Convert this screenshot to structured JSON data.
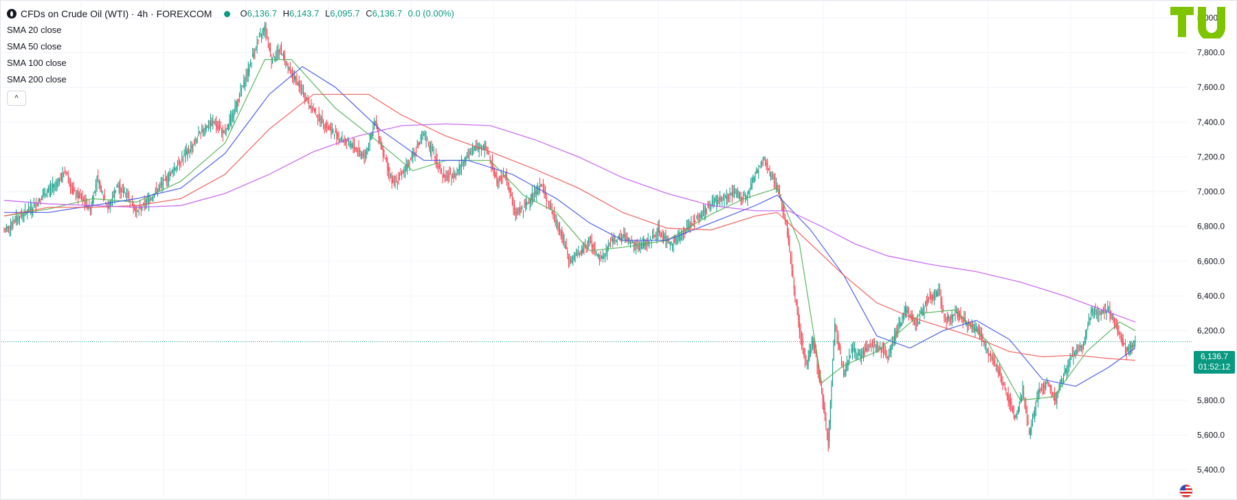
{
  "header": {
    "title": "CFDs on Crude Oil (WTI) · 4h · FOREXCOM",
    "ohlc": [
      {
        "key": "O",
        "value": "6,136.7"
      },
      {
        "key": "H",
        "value": "6,143.7"
      },
      {
        "key": "L",
        "value": "6,095.7"
      },
      {
        "key": "C",
        "value": "6,136.7"
      },
      {
        "key": "",
        "value": "0.0 (0.00%)"
      }
    ]
  },
  "indicators": [
    {
      "label": "SMA 20 close",
      "color": "#4caf50"
    },
    {
      "label": "SMA 50 close",
      "color": "#3f51e6"
    },
    {
      "label": "SMA 100 close",
      "color": "#ef5350"
    },
    {
      "label": "SMA 200 close",
      "color": "#c154f0"
    }
  ],
  "collapse_glyph": "^",
  "last_price": {
    "value": "6,136.7",
    "countdown": "01:52:12",
    "color": "#089981"
  },
  "colors": {
    "up": "#089981",
    "down": "#f23645",
    "grid": "#f0f3fa",
    "axis_text": "#131722"
  },
  "chart_data": {
    "type": "candlestick",
    "ylim": [
      5400,
      8100
    ],
    "y_ticks": [
      "8,000.0",
      "7,800.0",
      "7,600.0",
      "7,400.0",
      "7,200.0",
      "7,000.0",
      "6,800.0",
      "6,600.0",
      "6,400.0",
      "6,200.0",
      "6,000.0",
      "5,800.0",
      "5,600.0",
      "5,400.0"
    ],
    "y_tick_values": [
      8000,
      7800,
      7600,
      7400,
      7200,
      7000,
      6800,
      6600,
      6400,
      6200,
      6000,
      5800,
      5600,
      5400
    ],
    "last_value": 6136.7,
    "close_path": [
      [
        0,
        6770
      ],
      [
        12,
        6850
      ],
      [
        24,
        6900
      ],
      [
        36,
        6980
      ],
      [
        48,
        7050
      ],
      [
        56,
        7120
      ],
      [
        62,
        7000
      ],
      [
        70,
        6960
      ],
      [
        78,
        6900
      ],
      [
        84,
        7080
      ],
      [
        94,
        6900
      ],
      [
        102,
        7030
      ],
      [
        112,
        6980
      ],
      [
        120,
        6880
      ],
      [
        130,
        6950
      ],
      [
        140,
        7020
      ],
      [
        150,
        7100
      ],
      [
        160,
        7180
      ],
      [
        170,
        7260
      ],
      [
        180,
        7360
      ],
      [
        190,
        7400
      ],
      [
        200,
        7330
      ],
      [
        210,
        7500
      ],
      [
        220,
        7680
      ],
      [
        228,
        7840
      ],
      [
        236,
        7950
      ],
      [
        242,
        7760
      ],
      [
        250,
        7820
      ],
      [
        258,
        7700
      ],
      [
        266,
        7620
      ],
      [
        276,
        7500
      ],
      [
        286,
        7420
      ],
      [
        296,
        7350
      ],
      [
        306,
        7300
      ],
      [
        316,
        7260
      ],
      [
        326,
        7200
      ],
      [
        336,
        7400
      ],
      [
        344,
        7200
      ],
      [
        352,
        7040
      ],
      [
        362,
        7120
      ],
      [
        372,
        7240
      ],
      [
        380,
        7320
      ],
      [
        390,
        7200
      ],
      [
        398,
        7080
      ],
      [
        408,
        7100
      ],
      [
        418,
        7200
      ],
      [
        428,
        7260
      ],
      [
        436,
        7260
      ],
      [
        446,
        7060
      ],
      [
        454,
        7100
      ],
      [
        462,
        6880
      ],
      [
        470,
        6900
      ],
      [
        478,
        6980
      ],
      [
        486,
        7040
      ],
      [
        496,
        6880
      ],
      [
        504,
        6760
      ],
      [
        512,
        6600
      ],
      [
        522,
        6650
      ],
      [
        530,
        6720
      ],
      [
        540,
        6600
      ],
      [
        550,
        6720
      ],
      [
        562,
        6740
      ],
      [
        572,
        6680
      ],
      [
        582,
        6700
      ],
      [
        592,
        6780
      ],
      [
        602,
        6700
      ],
      [
        612,
        6740
      ],
      [
        622,
        6820
      ],
      [
        632,
        6880
      ],
      [
        642,
        6940
      ],
      [
        652,
        6960
      ],
      [
        662,
        6990
      ],
      [
        672,
        6960
      ],
      [
        680,
        7100
      ],
      [
        688,
        7180
      ],
      [
        696,
        7080
      ],
      [
        702,
        6980
      ],
      [
        708,
        6820
      ],
      [
        714,
        6500
      ],
      [
        720,
        6200
      ],
      [
        726,
        6000
      ],
      [
        732,
        6150
      ],
      [
        740,
        5850
      ],
      [
        746,
        5550
      ],
      [
        752,
        6250
      ],
      [
        760,
        5950
      ],
      [
        768,
        6100
      ],
      [
        776,
        6060
      ],
      [
        784,
        6120
      ],
      [
        792,
        6100
      ],
      [
        800,
        6050
      ],
      [
        808,
        6200
      ],
      [
        816,
        6320
      ],
      [
        826,
        6240
      ],
      [
        836,
        6380
      ],
      [
        846,
        6420
      ],
      [
        852,
        6260
      ],
      [
        862,
        6300
      ],
      [
        872,
        6240
      ],
      [
        882,
        6200
      ],
      [
        892,
        6060
      ],
      [
        900,
        5980
      ],
      [
        908,
        5820
      ],
      [
        916,
        5700
      ],
      [
        922,
        5860
      ],
      [
        928,
        5600
      ],
      [
        936,
        5840
      ],
      [
        944,
        5900
      ],
      [
        952,
        5800
      ],
      [
        960,
        5960
      ],
      [
        968,
        6080
      ],
      [
        976,
        6100
      ],
      [
        984,
        6320
      ],
      [
        992,
        6300
      ],
      [
        1000,
        6320
      ],
      [
        1008,
        6200
      ],
      [
        1016,
        6080
      ],
      [
        1024,
        6136.7
      ]
    ],
    "sma_paths": [
      {
        "name": "SMA 20 close",
        "points": [
          [
            0,
            6860
          ],
          [
            40,
            6900
          ],
          [
            80,
            6960
          ],
          [
            120,
            6940
          ],
          [
            160,
            7060
          ],
          [
            200,
            7280
          ],
          [
            236,
            7760
          ],
          [
            260,
            7760
          ],
          [
            300,
            7480
          ],
          [
            340,
            7280
          ],
          [
            370,
            7120
          ],
          [
            400,
            7180
          ],
          [
            440,
            7180
          ],
          [
            470,
            6980
          ],
          [
            500,
            6880
          ],
          [
            530,
            6660
          ],
          [
            560,
            6680
          ],
          [
            600,
            6720
          ],
          [
            640,
            6870
          ],
          [
            670,
            6960
          ],
          [
            700,
            7020
          ],
          [
            720,
            6700
          ],
          [
            740,
            5900
          ],
          [
            760,
            6000
          ],
          [
            790,
            6080
          ],
          [
            830,
            6300
          ],
          [
            860,
            6320
          ],
          [
            890,
            6140
          ],
          [
            920,
            5800
          ],
          [
            950,
            5820
          ],
          [
            980,
            6080
          ],
          [
            1010,
            6250
          ],
          [
            1024,
            6200
          ]
        ]
      },
      {
        "name": "SMA 50 close",
        "points": [
          [
            0,
            6880
          ],
          [
            40,
            6880
          ],
          [
            80,
            6920
          ],
          [
            120,
            6960
          ],
          [
            160,
            7020
          ],
          [
            200,
            7220
          ],
          [
            240,
            7560
          ],
          [
            270,
            7720
          ],
          [
            300,
            7600
          ],
          [
            340,
            7360
          ],
          [
            380,
            7180
          ],
          [
            420,
            7180
          ],
          [
            460,
            7100
          ],
          [
            500,
            6960
          ],
          [
            530,
            6820
          ],
          [
            560,
            6720
          ],
          [
            600,
            6720
          ],
          [
            640,
            6820
          ],
          [
            680,
            6920
          ],
          [
            700,
            6980
          ],
          [
            730,
            6780
          ],
          [
            760,
            6520
          ],
          [
            790,
            6170
          ],
          [
            820,
            6100
          ],
          [
            850,
            6200
          ],
          [
            880,
            6260
          ],
          [
            910,
            6150
          ],
          [
            940,
            5920
          ],
          [
            970,
            5880
          ],
          [
            1000,
            5990
          ],
          [
            1024,
            6100
          ]
        ]
      },
      {
        "name": "SMA 100 close",
        "points": [
          [
            0,
            6860
          ],
          [
            40,
            6910
          ],
          [
            80,
            6910
          ],
          [
            120,
            6920
          ],
          [
            160,
            6960
          ],
          [
            200,
            7100
          ],
          [
            240,
            7360
          ],
          [
            280,
            7560
          ],
          [
            330,
            7560
          ],
          [
            360,
            7440
          ],
          [
            400,
            7320
          ],
          [
            440,
            7230
          ],
          [
            480,
            7130
          ],
          [
            520,
            7020
          ],
          [
            560,
            6880
          ],
          [
            600,
            6790
          ],
          [
            640,
            6780
          ],
          [
            680,
            6860
          ],
          [
            700,
            6880
          ],
          [
            730,
            6700
          ],
          [
            760,
            6520
          ],
          [
            790,
            6360
          ],
          [
            820,
            6280
          ],
          [
            850,
            6220
          ],
          [
            880,
            6160
          ],
          [
            910,
            6080
          ],
          [
            940,
            6050
          ],
          [
            970,
            6060
          ],
          [
            1000,
            6040
          ],
          [
            1024,
            6030
          ]
        ]
      },
      {
        "name": "SMA 200 close",
        "points": [
          [
            0,
            6950
          ],
          [
            40,
            6930
          ],
          [
            80,
            6920
          ],
          [
            120,
            6910
          ],
          [
            160,
            6920
          ],
          [
            200,
            6990
          ],
          [
            240,
            7100
          ],
          [
            280,
            7230
          ],
          [
            320,
            7320
          ],
          [
            360,
            7380
          ],
          [
            400,
            7390
          ],
          [
            440,
            7380
          ],
          [
            480,
            7300
          ],
          [
            520,
            7200
          ],
          [
            560,
            7080
          ],
          [
            600,
            6990
          ],
          [
            640,
            6920
          ],
          [
            680,
            6890
          ],
          [
            710,
            6890
          ],
          [
            740,
            6800
          ],
          [
            770,
            6700
          ],
          [
            800,
            6630
          ],
          [
            840,
            6580
          ],
          [
            880,
            6540
          ],
          [
            920,
            6480
          ],
          [
            960,
            6400
          ],
          [
            990,
            6330
          ],
          [
            1024,
            6250
          ]
        ]
      }
    ]
  }
}
